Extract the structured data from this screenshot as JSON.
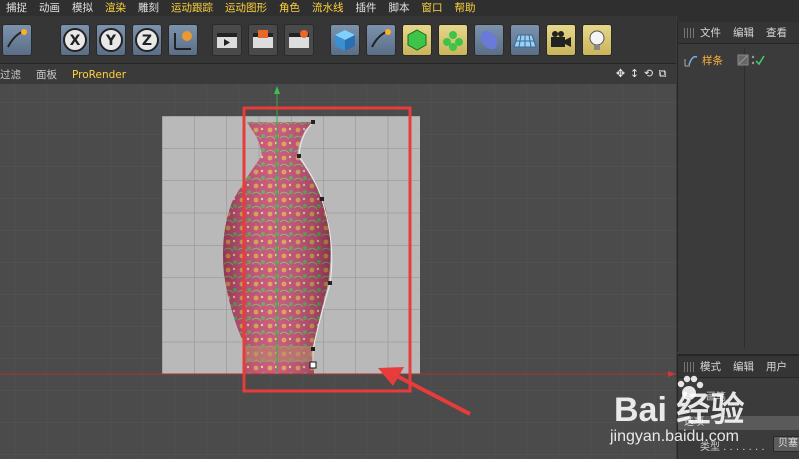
{
  "menu": {
    "items": [
      "捕捉",
      "动画",
      "模拟",
      "渲染",
      "雕刻",
      "运动跟踪",
      "运动图形",
      "角色",
      "流水线",
      "插件",
      "脚本",
      "窗口",
      "帮助"
    ],
    "highlighted": [
      "渲染",
      "运动跟踪",
      "运动图形",
      "角色",
      "流水线",
      "窗口",
      "帮助"
    ]
  },
  "toolbar": {
    "tools": [
      {
        "name": "pen-icon",
        "kind": "blue"
      },
      {
        "name": "axis-x-icon",
        "kind": "blue",
        "label": "X"
      },
      {
        "name": "axis-y-icon",
        "kind": "blue",
        "label": "Y"
      },
      {
        "name": "axis-z-icon",
        "kind": "blue",
        "label": "Z"
      },
      {
        "name": "world-coord-icon",
        "kind": "blue"
      },
      {
        "name": "render-view-icon",
        "kind": "gray"
      },
      {
        "name": "render-picture-viewer-icon",
        "kind": "gray"
      },
      {
        "name": "render-settings-icon",
        "kind": "gray"
      },
      {
        "name": "cube-icon",
        "kind": "blue"
      },
      {
        "name": "spline-pen-icon",
        "kind": "blue"
      },
      {
        "name": "subdivision-icon",
        "kind": "yellow"
      },
      {
        "name": "cloner-icon",
        "kind": "yellow"
      },
      {
        "name": "deformer-icon",
        "kind": "blue"
      },
      {
        "name": "floor-icon",
        "kind": "blue"
      },
      {
        "name": "camera-icon",
        "kind": "yellow"
      },
      {
        "name": "light-icon",
        "kind": "yellow"
      }
    ]
  },
  "viewport": {
    "menus": [
      "过滤",
      "面板",
      "ProRender"
    ]
  },
  "object_manager": {
    "tabs": [
      "文件",
      "编辑",
      "查看"
    ],
    "object_name": "样条"
  },
  "attribute_manager": {
    "tabs": [
      "模式",
      "编辑",
      "用户"
    ],
    "row1": "画笔",
    "row2": "选项",
    "type_label": "类型 . . . . . . .",
    "type_value": "贝塞"
  },
  "watermark": {
    "logo": "Bai 经验",
    "url": "jingyan.baidu.com"
  },
  "colors": {
    "accent": "#ffd23a",
    "selection_box": "#e83b3b",
    "object_name": "#ffb33a"
  }
}
